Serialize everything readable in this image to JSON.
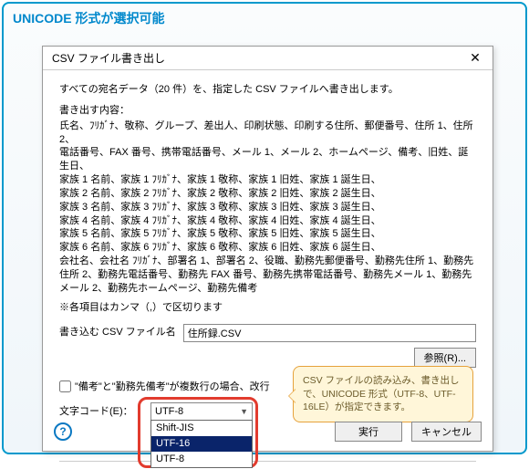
{
  "caption": "UNICODE 形式が選択可能",
  "dialog": {
    "title": "CSV ファイル書き出し",
    "close": "✕",
    "description": "すべての宛名データ（20 件）を、指定した CSV ファイルへ書き出します。",
    "export_label": "書き出す内容：",
    "fields_text": "氏名、ﾌﾘｶﾞﾅ、敬称、グループ、差出人、印刷状態、印刷する住所、郵便番号、住所 1、住所 2、\n電話番号、FAX 番号、携帯電話番号、メール 1、メール 2、ホームページ、備考、旧姓、誕生日、\n家族 1 名前、家族 1 ﾌﾘｶﾞﾅ、家族 1 敬称、家族 1 旧姓、家族 1 誕生日、\n家族 2 名前、家族 2 ﾌﾘｶﾞﾅ、家族 2 敬称、家族 2 旧姓、家族 2 誕生日、\n家族 3 名前、家族 3 ﾌﾘｶﾞﾅ、家族 3 敬称、家族 3 旧姓、家族 3 誕生日、\n家族 4 名前、家族 4 ﾌﾘｶﾞﾅ、家族 4 敬称、家族 4 旧姓、家族 4 誕生日、\n家族 5 名前、家族 5 ﾌﾘｶﾞﾅ、家族 5 敬称、家族 5 旧姓、家族 5 誕生日、\n家族 6 名前、家族 6 ﾌﾘｶﾞﾅ、家族 6 敬称、家族 6 旧姓、家族 6 誕生日、\n会社名、会社名 ﾌﾘｶﾞﾅ、部署名 1、部署名 2、役職、勤務先郵便番号、勤務先住所 1、勤務先住所 2、勤務先電話番号、勤務先 FAX 番号、勤務先携帯電話番号、勤務先メール 1、勤務先メール 2、勤務先ホームページ、勤務先備考",
    "note_text": "※各項目はカンマ（,）で区切ります",
    "filename_label": "書き込む CSV ファイル名",
    "filename_value": "住所録.CSV",
    "browse_label": "参照(R)...",
    "checkbox_label": "\"備考\"と\"勤務先備考\"が複数行の場合、改行",
    "encoding_label": "文字コード(E)：",
    "encoding_value": "UTF-8",
    "options": [
      "Shift-JIS",
      "UTF-16",
      "UTF-8"
    ],
    "run_label": "実行",
    "cancel_label": "キャンセル",
    "help_label": "?"
  },
  "callout_text": "CSV ファイルの読み込み、書き出しで、UNICODE 形式（UTF-8、UTF-16LE）が指定できます。"
}
